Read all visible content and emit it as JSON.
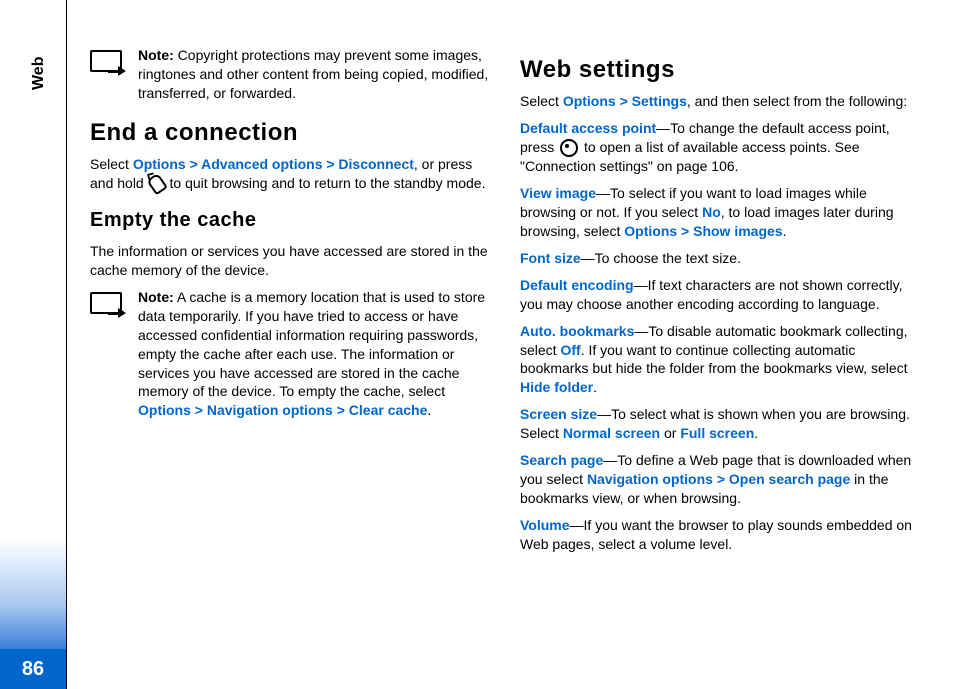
{
  "sidebar": {
    "tab": "Web",
    "pageNumber": "86"
  },
  "col1": {
    "note1": {
      "prefix": "Note:",
      "body": " Copyright protections may prevent some images, ringtones and other content from being copied, modified, transferred, or forwarded."
    },
    "h_end": "End a connection",
    "p_end_1": "Select ",
    "p_end_link": "Options > Advanced options > Disconnect",
    "p_end_2": ", or press and hold ",
    "p_end_3": " to quit browsing and to return to the standby mode.",
    "h_empty": "Empty the cache",
    "p_empty": "The information or services you have accessed are stored in the cache memory of the device.",
    "note2": {
      "prefix": "Note:",
      "body1": " A cache is a memory location that is used to store data temporarily. If you have tried to access or have accessed confidential information requiring passwords, empty the cache after each use. The information or services you have accessed are stored in the cache memory of the device. To empty the cache, select ",
      "link": "Options > Navigation options > Clear cache",
      "body2": "."
    }
  },
  "col2": {
    "h_settings": "Web settings",
    "p_intro_1": "Select ",
    "p_intro_link": "Options > Settings",
    "p_intro_2": ", and then select from the following:",
    "dap_label": "Default access point",
    "dap_1": "—To change the default access point, press ",
    "dap_2": " to open a list of available access points. See \"Connection settings\" on page 106.",
    "vi_label": "View image",
    "vi_1": "—To select if you want to load images while browsing or not. If you select ",
    "vi_no": "No",
    "vi_2": ", to load images later during browsing, select ",
    "vi_link": "Options > Show images",
    "vi_3": ".",
    "fs_label": "Font size",
    "fs_body": "—To choose the text size.",
    "de_label": "Default encoding",
    "de_body": "—If text characters are not shown correctly, you may choose another encoding according to language.",
    "ab_label": "Auto. bookmarks",
    "ab_1": "—To disable automatic bookmark collecting, select ",
    "ab_off": "Off",
    "ab_2": ". If you want to continue collecting automatic bookmarks but hide the folder from the bookmarks view, select ",
    "ab_hide": "Hide folder",
    "ab_3": ".",
    "ss_label": "Screen size",
    "ss_1": "—To select what is shown when you are browsing. Select ",
    "ss_normal": "Normal screen",
    "ss_or": " or ",
    "ss_full": "Full screen",
    "ss_3": ".",
    "sp_label": "Search page",
    "sp_1": "—To define a Web page that is downloaded when you select ",
    "sp_link": "Navigation options > Open search page",
    "sp_2": " in the bookmarks view, or when browsing.",
    "vol_label": "Volume",
    "vol_body": "—If you want the browser to play sounds embedded on Web pages, select a volume level."
  }
}
